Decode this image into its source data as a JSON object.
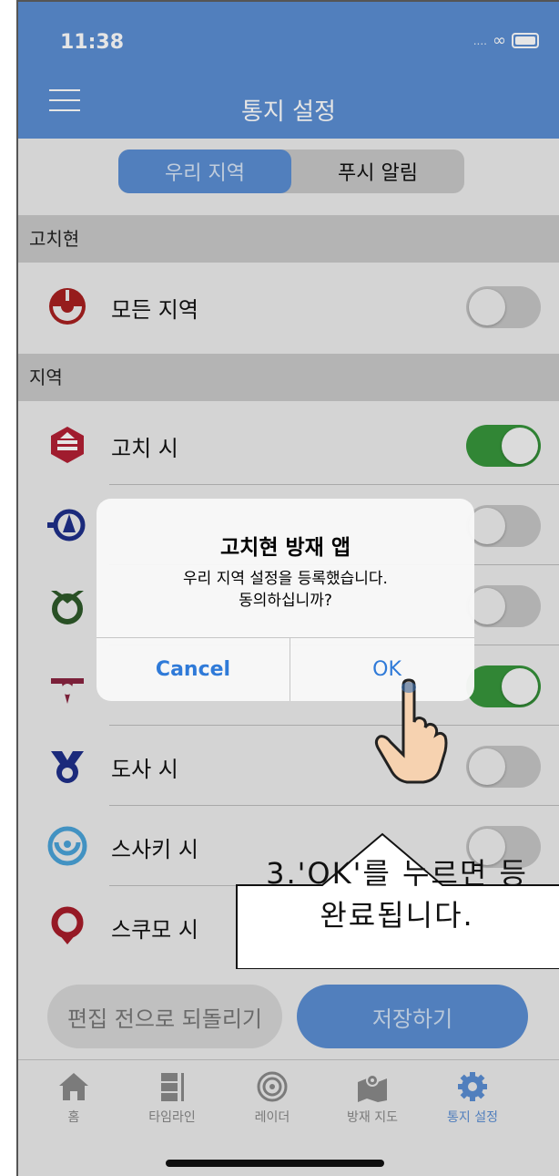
{
  "status": {
    "time": "11:38"
  },
  "header": {
    "title": "통지 설정"
  },
  "segments": [
    {
      "label": "우리 지역",
      "active": true
    },
    {
      "label": "푸시 알림",
      "active": false
    }
  ],
  "sections": {
    "prefecture": {
      "title": "고치현"
    },
    "region": {
      "title": "지역"
    }
  },
  "rows": [
    {
      "label": "모든 지역",
      "toggle": false
    },
    {
      "label": "고치 시",
      "toggle": true
    },
    {
      "label": "",
      "toggle": false
    },
    {
      "label": "",
      "toggle": false
    },
    {
      "label": "",
      "toggle": true
    },
    {
      "label": "도사 시",
      "toggle": false
    },
    {
      "label": "스사키 시",
      "toggle": false
    },
    {
      "label": "스쿠모 시",
      "toggle": false
    }
  ],
  "buttons": {
    "revert": "편집 전으로 되돌리기",
    "save": "저장하기"
  },
  "tabs": [
    {
      "label": "홈",
      "icon": "home-icon"
    },
    {
      "label": "타임라인",
      "icon": "timeline-icon"
    },
    {
      "label": "레이더",
      "icon": "radar-icon"
    },
    {
      "label": "방재 지도",
      "icon": "map-icon"
    },
    {
      "label": "통지 설정",
      "icon": "gear-icon",
      "active": true
    }
  ],
  "alert": {
    "title": "고치현 방재 앱",
    "message_line1": "우리 지역 설정을 등록했습니다.",
    "message_line2": "동의하십니까?",
    "cancel": "Cancel",
    "ok": "OK"
  },
  "callout": {
    "line1": "3.'OK'를 누르면 등",
    "line2": "완료됩니다."
  },
  "colors": {
    "accent": "#5b8ed3",
    "toggle_on": "#37963b",
    "toggle_off": "#c6c6c6",
    "alert_button": "#2f7ad8"
  }
}
